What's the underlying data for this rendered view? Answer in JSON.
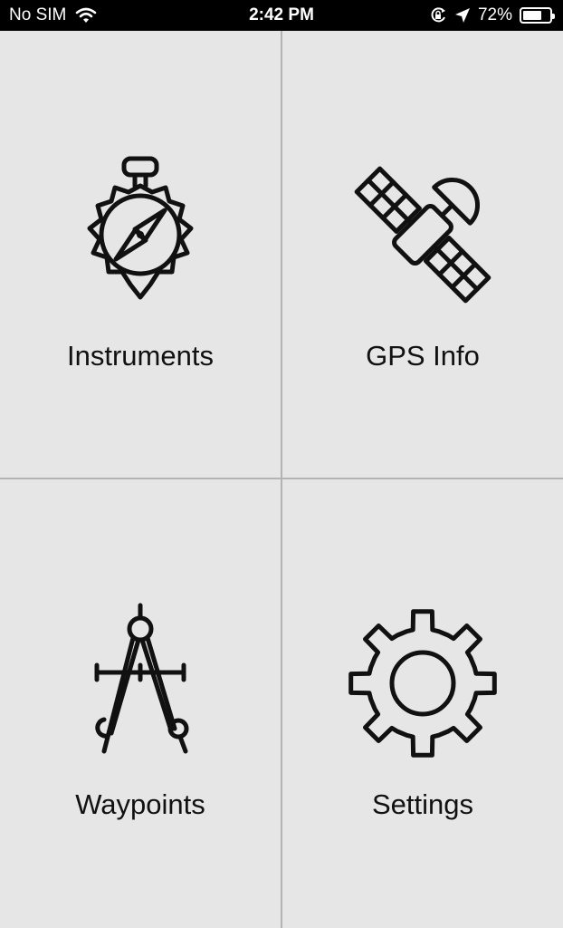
{
  "status_bar": {
    "carrier": "No SIM",
    "time": "2:42 PM",
    "battery_percent": "72%",
    "battery_level": 0.72,
    "icons": [
      "wifi-icon",
      "orientation-lock-icon",
      "location-arrow-icon",
      "battery-icon"
    ]
  },
  "menu": {
    "items": [
      {
        "label": "Instruments",
        "icon": "compass-icon"
      },
      {
        "label": "GPS Info",
        "icon": "satellite-icon"
      },
      {
        "label": "Waypoints",
        "icon": "drafting-compass-icon"
      },
      {
        "label": "Settings",
        "icon": "gear-icon"
      }
    ]
  },
  "colors": {
    "background": "#e6e6e6",
    "divider": "#b3b3b3",
    "status_bar": "#000000",
    "text": "#111111"
  }
}
